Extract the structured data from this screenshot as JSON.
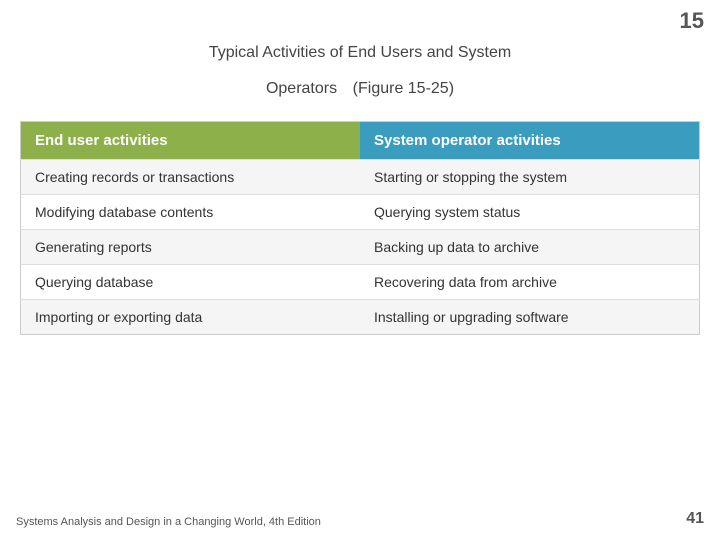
{
  "page": {
    "chapter_number": "15",
    "page_number": "41",
    "title_line1": "Typical Activities of End Users and System",
    "title_line2": "Operators",
    "title_figure": "(Figure 15-25)",
    "footer_text": "Systems Analysis and Design in a Changing World, 4th Edition"
  },
  "table": {
    "headers": {
      "end_user": "End user activities",
      "sys_op": "System operator activities"
    },
    "rows": [
      {
        "end_user": "Creating records or transactions",
        "sys_op": "Starting or stopping the system"
      },
      {
        "end_user": "Modifying database contents",
        "sys_op": "Querying system status"
      },
      {
        "end_user": "Generating reports",
        "sys_op": "Backing up data to archive"
      },
      {
        "end_user": "Querying database",
        "sys_op": "Recovering data from archive"
      },
      {
        "end_user": "Importing or exporting data",
        "sys_op": "Installing or upgrading software"
      }
    ]
  }
}
